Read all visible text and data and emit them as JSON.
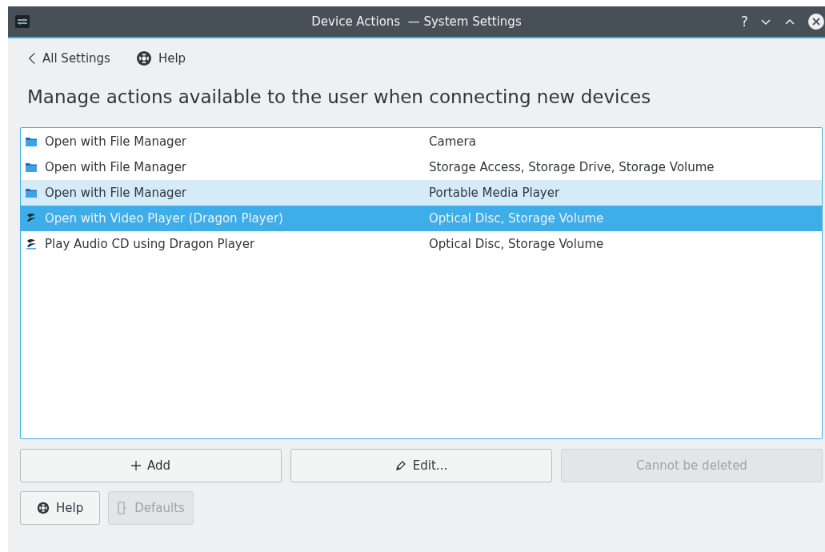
{
  "window": {
    "title": "Device Actions  — System Settings",
    "buttons": [
      "?"
    ]
  },
  "nav": {
    "back": "All Settings",
    "help": "Help"
  },
  "heading": "Manage actions available to the user when connecting new devices",
  "actions": [
    {
      "name": "Open with File Manager",
      "devices": "Camera",
      "kind": "folder",
      "selected": false,
      "highlighted": false
    },
    {
      "name": "Open with File Manager",
      "devices": "Storage Access, Storage Drive, Storage Volume",
      "kind": "folder",
      "selected": false,
      "highlighted": false
    },
    {
      "name": "Open with File Manager",
      "devices": "Portable Media Player",
      "kind": "folder",
      "selected": false,
      "highlighted": true
    },
    {
      "name": "Open with Video Player (Dragon Player)",
      "devices": "Optical Disc, Storage Volume",
      "kind": "dragon",
      "selected": true,
      "highlighted": false
    },
    {
      "name": "Play Audio CD using Dragon Player",
      "devices": "Optical Disc, Storage Volume",
      "kind": "dragon",
      "selected": false,
      "highlighted": false
    }
  ],
  "action_buttons": [
    {
      "label": "Add",
      "kind": "add",
      "disabled": false
    },
    {
      "label": "Edit...",
      "kind": "edit",
      "disabled": false
    },
    {
      "label": "Cannot be deleted",
      "kind": "none",
      "disabled": true
    }
  ],
  "footer_buttons": [
    {
      "label": "Help",
      "kind": "help",
      "disabled": false
    },
    {
      "label": "Defaults",
      "kind": "defaults",
      "disabled": true
    }
  ]
}
